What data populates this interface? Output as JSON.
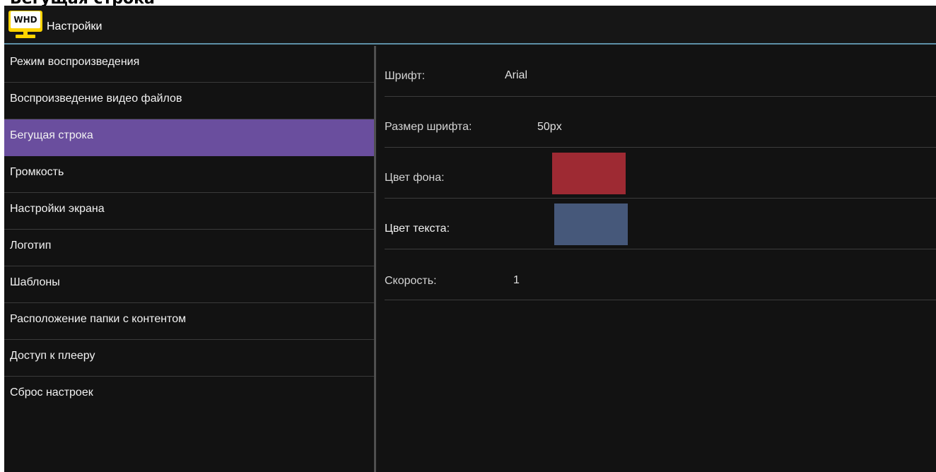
{
  "header": {
    "top_fragment": "Бегущая строка",
    "logo_text": "WHD",
    "title": "Настройки"
  },
  "sidebar": {
    "active_index": 2,
    "items": [
      {
        "label": "Режим воспроизведения"
      },
      {
        "label": "Воспроизведение видео файлов"
      },
      {
        "label": "Бегущая строка"
      },
      {
        "label": "Громкость"
      },
      {
        "label": "Настройки экрана"
      },
      {
        "label": "Логотип"
      },
      {
        "label": "Шаблоны"
      },
      {
        "label": "Расположение папки с контентом"
      },
      {
        "label": "Доступ к плееру"
      },
      {
        "label": "Сброс настроек"
      }
    ]
  },
  "settings": {
    "font": {
      "label": "Шрифт:",
      "value": "Arial"
    },
    "font_size": {
      "label": "Размер шрифта:",
      "value": "50px"
    },
    "bg_color": {
      "label": "Цвет фона:",
      "color": "#9e2a33"
    },
    "text_color": {
      "label": "Цвет текста:",
      "color": "#46587a"
    },
    "speed": {
      "label": "Скорость:",
      "value": "1"
    }
  },
  "colors": {
    "accent_selected": "#6a4e9e",
    "header_line": "#5d8fa6",
    "logo_yellow": "#ffd400"
  }
}
